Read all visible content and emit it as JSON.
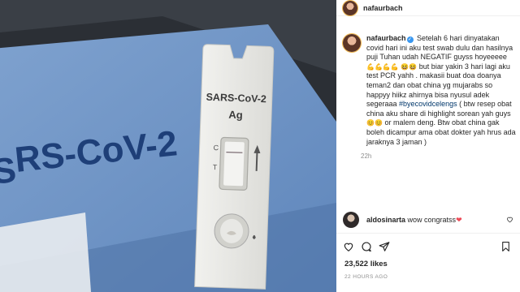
{
  "photo": {
    "box_text": "RS-CoV-2",
    "box_side_prefix": "S",
    "test_title": "SARS-CoV-2",
    "test_subtitle": "Ag",
    "label_c": "C",
    "label_t": "T"
  },
  "header": {
    "username": "nafaurbach"
  },
  "post": {
    "username": "nafaurbach",
    "caption_1": "Setelah 6 hari dinyatakan covid hari ini aku test swab dulu dan hasilnya puji Tuhan udah NEGATIF guyss hoyeeeee",
    "emoji_1": "💪💪💪💪",
    "emoji_2": "😆😆",
    "caption_2": "but biar yakin 3 hari lagi aku test PCR yahh . makasii buat doa doanya teman2 dan obat china yg mujarabs so happyy hiikz ahirnya bisa nyusul adek segeraaa",
    "hashtag": "#byecovidcelengs",
    "caption_3": "( btw resep obat china aku share di highlight sorean yah guys",
    "emoji_3": "😊😊",
    "caption_4": "or malem deng. Btw obat china gak boleh dicampur ama obat dokter yah hrus ada jaraknya 3 jaman )",
    "time": "22h"
  },
  "comment": {
    "username": "aldosinarta",
    "text": "wow congratss",
    "heart": "❤"
  },
  "likes": "23,522 likes",
  "posted_ago": "22 HOURS AGO",
  "icons": [
    "heart-icon",
    "comment-icon",
    "share-icon",
    "bookmark-icon",
    "verified-badge-icon"
  ],
  "colors": {
    "link": "#00376b",
    "muted": "#8e8e8e",
    "verified": "#3897f0",
    "heart": "#ed4956"
  }
}
